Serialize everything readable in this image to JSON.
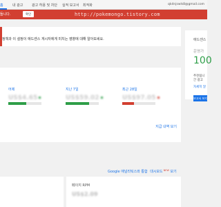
{
  "nav": {
    "tabs": [
      "홈",
      "내 광고",
      "광고 허용 및 차단",
      "실적 보고서",
      "최적화"
    ],
    "email": "qkdnjswls8@gmail.com"
  },
  "banner": {
    "text": "둡니다.",
    "button_label": "확인",
    "watermark": "http://pokemongo.tistory.com"
  },
  "notice": {
    "text": "정책과 이 설정이 애드센스 게시자에게 미치는 영향에 대해 알아보세요."
  },
  "earnings": {
    "metrics": [
      {
        "label": "어제",
        "value": "US$4.65",
        "trend": "up",
        "fraction": 0.55
      },
      {
        "label": "지난 7일",
        "value": "US$59.02",
        "trend": "up",
        "fraction": 0.7
      },
      {
        "label": "최근 28일",
        "value": "US$97.05",
        "trend": "down",
        "fraction": 0.35
      }
    ],
    "view_more": "지급 내역 보기"
  },
  "links": {
    "analytics": "Google 애널리틱스와 통합",
    "dashboard": "대시보드",
    "new_badge": "NEW",
    "view": "보기"
  },
  "rpm_card": {
    "label": "페이지 RPM",
    "value": "US$2.09"
  },
  "sidebar": {
    "title": "애드센스",
    "status_label": "운영가",
    "status_value": "100",
    "desc_line1": "추천됩니",
    "desc_line2": "간 광고",
    "link": "자세히 알",
    "button_label": "보고서 보기"
  },
  "colors": {
    "brand_blue": "#1a73e8",
    "alert_red": "#d23f31",
    "success_green": "#2e9e48"
  }
}
